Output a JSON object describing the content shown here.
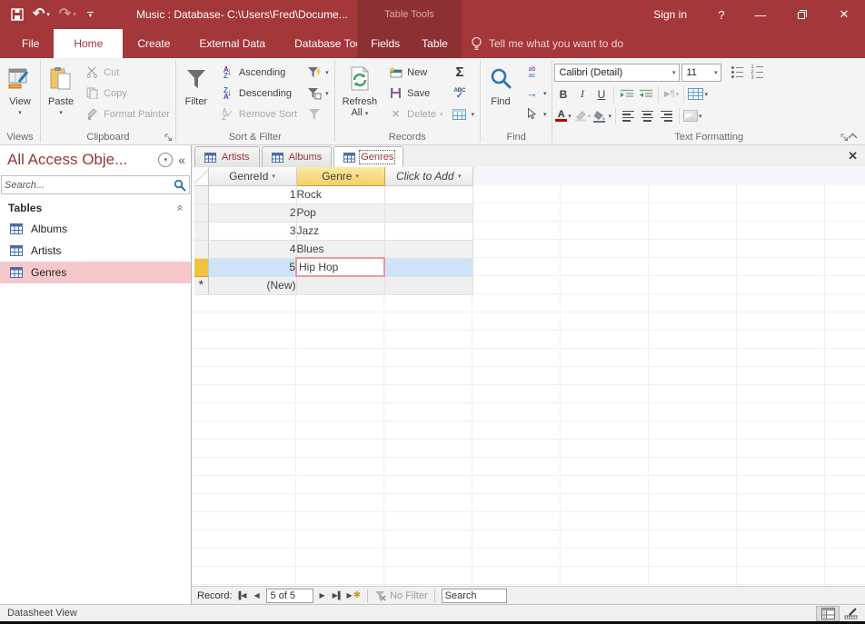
{
  "titlebar": {
    "title": "Music : Database- C:\\Users\\Fred\\Docume...",
    "context_label": "Table Tools",
    "sign_in": "Sign in",
    "help": "?"
  },
  "tabs": {
    "file": "File",
    "home": "Home",
    "create": "Create",
    "external_data": "External Data",
    "database_tools": "Database Tools",
    "fields": "Fields",
    "table": "Table",
    "tell_me": "Tell me what you want to do"
  },
  "ribbon": {
    "views": {
      "view": "View",
      "group_label": "Views"
    },
    "clipboard": {
      "paste": "Paste",
      "cut": "Cut",
      "copy": "Copy",
      "format_painter": "Format Painter",
      "group_label": "Clipboard"
    },
    "sort_filter": {
      "filter": "Filter",
      "ascending": "Ascending",
      "descending": "Descending",
      "remove_sort": "Remove Sort",
      "group_label": "Sort & Filter"
    },
    "records": {
      "refresh_1": "Refresh",
      "refresh_2": "All",
      "new": "New",
      "save": "Save",
      "delete": "Delete",
      "spelling_icon": "ABC",
      "group_label": "Records"
    },
    "find": {
      "find": "Find",
      "replace_top": "ab",
      "replace_bottom": "ac",
      "group_label": "Find"
    },
    "text_formatting": {
      "font_name": "Calibri (Detail)",
      "font_size": "11",
      "bold": "B",
      "italic": "I",
      "underline": "U",
      "font_color_letter": "A",
      "direction_glyph": "▶¶",
      "group_label": "Text Formatting"
    }
  },
  "nav_pane": {
    "title": "All Access Obje...",
    "search_placeholder": "Search...",
    "section_label": "Tables",
    "items": [
      {
        "label": "Albums"
      },
      {
        "label": "Artists"
      },
      {
        "label": "Genres"
      }
    ]
  },
  "doc_tabs": [
    {
      "label": "Artists"
    },
    {
      "label": "Albums"
    },
    {
      "label": "Genres"
    }
  ],
  "datasheet": {
    "columns": [
      {
        "name": "GenreId"
      },
      {
        "name": "Genre"
      },
      {
        "name": "Click to Add"
      }
    ],
    "rows": [
      {
        "id": "1",
        "genre": "Rock"
      },
      {
        "id": "2",
        "genre": "Pop"
      },
      {
        "id": "3",
        "genre": "Jazz"
      },
      {
        "id": "4",
        "genre": "Blues"
      },
      {
        "id": "5",
        "genre": "Hip Hop"
      }
    ],
    "selected_row": "5",
    "new_label": "(New)",
    "new_star": "*"
  },
  "record_nav": {
    "label": "Record:",
    "position": "5 of 5",
    "no_filter": "No Filter",
    "search_placeholder": "Search"
  },
  "status_bar": {
    "view_mode": "Datasheet View"
  },
  "colors": {
    "accent_red": "#a4373a",
    "contextual_red": "#8d3034",
    "nav_selected_pink": "#f6c8cd",
    "row_selected_blue": "#cde3f7",
    "header_selected_gold": "#f3cf67",
    "current_record_gold": "#f2c23e",
    "active_cell_border": "#e89aa0"
  }
}
